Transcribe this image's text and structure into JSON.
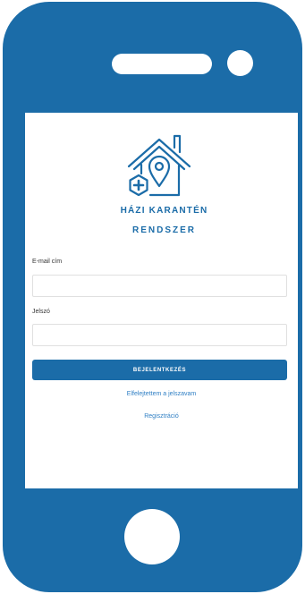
{
  "app": {
    "title_line1": "HÁZI KARANTÉN",
    "title_line2": "RENDSZER"
  },
  "form": {
    "email_label": "E-mail cím",
    "password_label": "Jelszó",
    "login_button": "BEJELENTKEZÉS",
    "forgot_link": "Elfelejtettem a jelszavam",
    "register_link": "Regisztráció"
  },
  "icons": {
    "logo": "house-location-pin-medical-icon"
  },
  "colors": {
    "phone_body": "#1b6ca8",
    "accent": "#1b6ca8",
    "link": "#2f7fc4",
    "label": "#333333",
    "input_border": "#e0e0e0"
  }
}
